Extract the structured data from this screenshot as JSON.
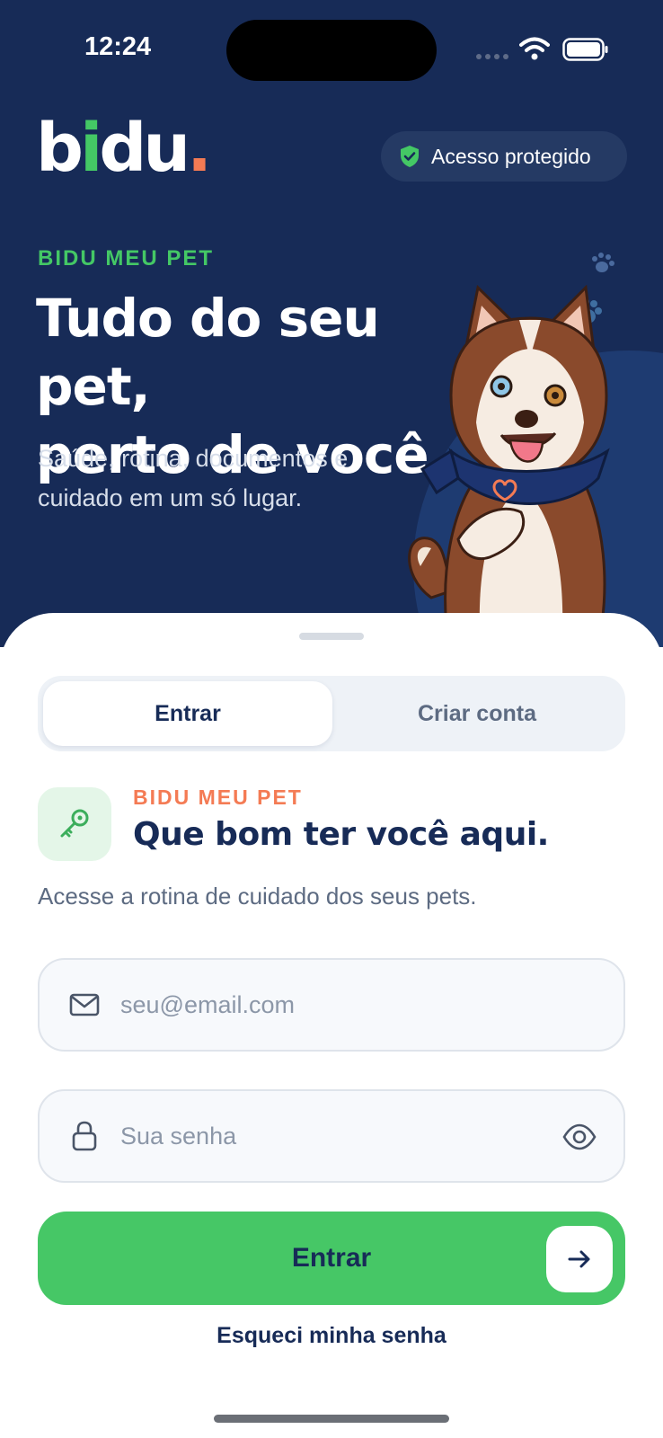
{
  "status_bar": {
    "time": "12:24"
  },
  "header": {
    "logo": {
      "part1": "b",
      "part2": "i",
      "part3": "du",
      "dot": "."
    },
    "secure_badge": "Acesso protegido"
  },
  "hero": {
    "eyebrow": "BIDU MEU PET",
    "headline_line1": "Tudo do seu pet,",
    "headline_line2": "perto de você.",
    "subhead_line1": "Saúde, rotina, documentos e",
    "subhead_line2": "cuidado em um só lugar."
  },
  "tabs": [
    {
      "label": "Entrar",
      "active": true
    },
    {
      "label": "Criar conta",
      "active": false
    }
  ],
  "card": {
    "eyebrow": "BIDU MEU PET",
    "title": "Que bom ter você aqui.",
    "description": "Acesse a rotina de cuidado dos seus pets."
  },
  "form": {
    "email_placeholder": "seu@email.com",
    "password_placeholder": "Sua senha",
    "submit_label": "Entrar",
    "forgot_label": "Esqueci minha senha"
  },
  "colors": {
    "hero_bg": "#172b57",
    "accent_green": "#46c766",
    "accent_orange": "#f47b54",
    "text_dark": "#172b57"
  },
  "icons": [
    "wifi-icon",
    "battery-icon",
    "shield-icon",
    "paw-icon",
    "key-icon",
    "mail-icon",
    "lock-icon",
    "eye-icon",
    "arrow-right-icon"
  ]
}
